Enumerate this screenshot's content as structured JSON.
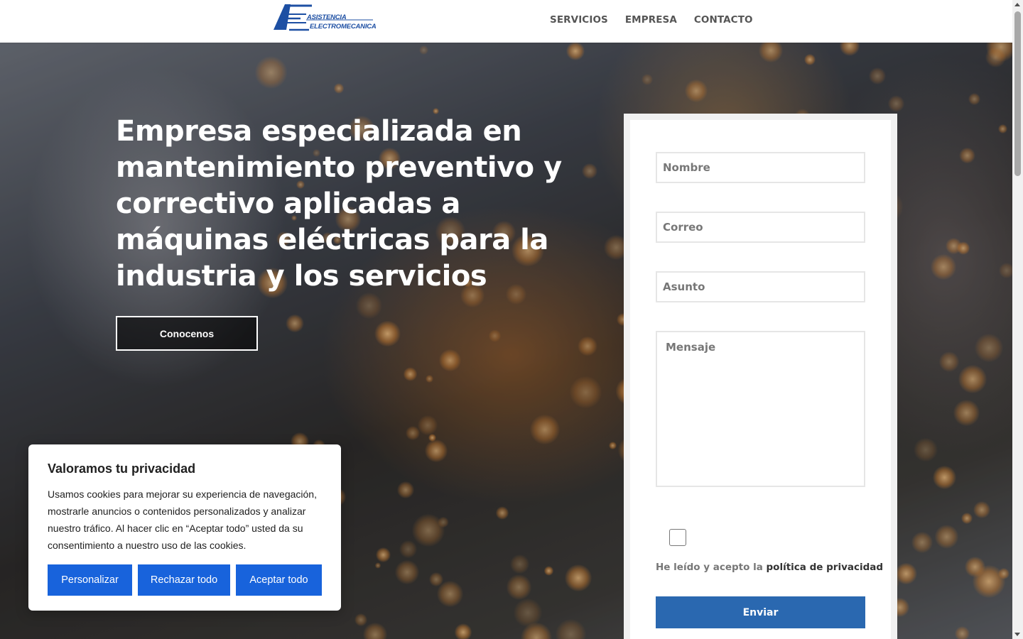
{
  "header": {
    "logo": {
      "line1": "ASISTENCIA",
      "line2": "ELECTROMECANICA",
      "icon": "ae-monogram-logo"
    },
    "nav": [
      {
        "label": "SERVICIOS"
      },
      {
        "label": "EMPRESA"
      },
      {
        "label": "CONTACTO"
      }
    ]
  },
  "hero": {
    "headline": "Empresa especializada en mantenimiento preventivo y correctivo aplicadas a máquinas eléctricas para la industria y los servicios",
    "cta_label": "Conocenos"
  },
  "form": {
    "name_placeholder": "Nombre",
    "email_placeholder": "Correo",
    "subject_placeholder": "Asunto",
    "message_placeholder": "Mensaje",
    "consent_text": "He leído y acepto la ",
    "consent_link": "política de privacidad",
    "submit_label": "Enviar"
  },
  "cookie": {
    "title": "Valoramos tu privacidad",
    "body": "Usamos cookies para mejorar su experiencia de navegación, mostrarle anuncios o contenidos personalizados y analizar nuestro tráfico. Al hacer clic en “Aceptar todo” usted da su consentimiento a nuestro uso de las cookies.",
    "buttons": [
      {
        "label": "Personalizar"
      },
      {
        "label": "Rechazar todo"
      },
      {
        "label": "Aceptar todo"
      }
    ]
  },
  "colors": {
    "brand_blue": "#1d4fa3",
    "submit_blue": "#2a68b0",
    "cookie_button_blue": "#1863dc"
  }
}
